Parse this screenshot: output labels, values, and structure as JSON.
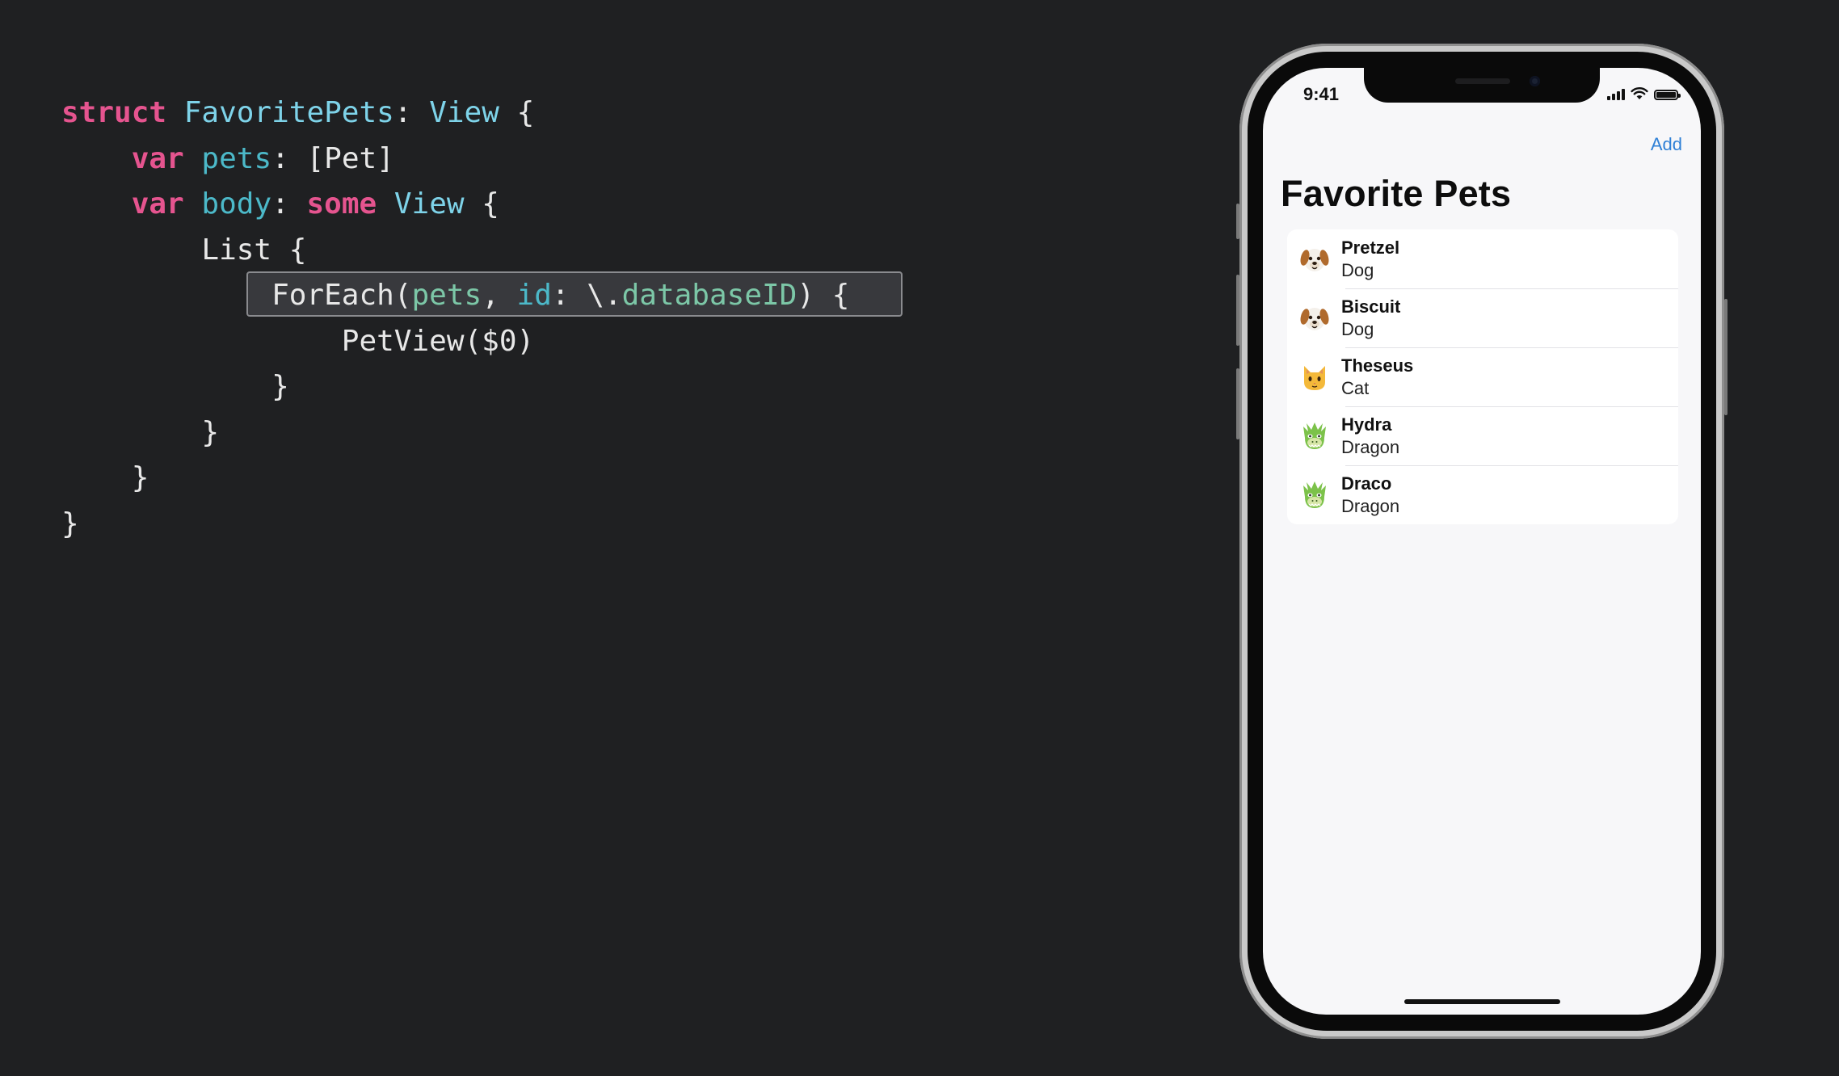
{
  "code": {
    "lines": [
      [
        {
          "t": "struct",
          "c": "kw"
        },
        {
          "t": " ",
          "c": "plain"
        },
        {
          "t": "FavoritePets",
          "c": "type"
        },
        {
          "t": ": ",
          "c": "plain"
        },
        {
          "t": "View",
          "c": "type"
        },
        {
          "t": " {",
          "c": "plain"
        }
      ],
      [
        {
          "t": "    ",
          "c": "plain"
        },
        {
          "t": "var",
          "c": "kw"
        },
        {
          "t": " ",
          "c": "plain"
        },
        {
          "t": "pets",
          "c": "prop"
        },
        {
          "t": ": [Pet]",
          "c": "plain"
        }
      ],
      [
        {
          "t": "    ",
          "c": "plain"
        },
        {
          "t": "var",
          "c": "kw"
        },
        {
          "t": " ",
          "c": "plain"
        },
        {
          "t": "body",
          "c": "prop"
        },
        {
          "t": ": ",
          "c": "plain"
        },
        {
          "t": "some",
          "c": "kw"
        },
        {
          "t": " ",
          "c": "plain"
        },
        {
          "t": "View",
          "c": "type"
        },
        {
          "t": " {",
          "c": "plain"
        }
      ],
      [
        {
          "t": "        List {",
          "c": "plain"
        }
      ],
      [
        {
          "t": "            ForEach(",
          "c": "plain"
        },
        {
          "t": "pets",
          "c": "arg"
        },
        {
          "t": ", ",
          "c": "plain"
        },
        {
          "t": "id",
          "c": "label"
        },
        {
          "t": ": \\.",
          "c": "plain"
        },
        {
          "t": "databaseID",
          "c": "arg"
        },
        {
          "t": ") {",
          "c": "plain"
        }
      ],
      [
        {
          "t": "                PetView($0)",
          "c": "plain"
        }
      ],
      [
        {
          "t": "            }",
          "c": "plain"
        }
      ],
      [
        {
          "t": "        }",
          "c": "plain"
        }
      ],
      [
        {
          "t": "    }",
          "c": "plain"
        }
      ],
      [
        {
          "t": "}",
          "c": "plain"
        }
      ]
    ],
    "highlighted_line": 4
  },
  "phone": {
    "status_time": "9:41",
    "nav_button": "Add",
    "title": "Favorite Pets",
    "pets": [
      {
        "name": "Pretzel",
        "kind": "Dog",
        "icon": "dog-face-icon"
      },
      {
        "name": "Biscuit",
        "kind": "Dog",
        "icon": "dog-face-icon"
      },
      {
        "name": "Theseus",
        "kind": "Cat",
        "icon": "cat-face-icon"
      },
      {
        "name": "Hydra",
        "kind": "Dragon",
        "icon": "dragon-face-icon"
      },
      {
        "name": "Draco",
        "kind": "Dragon",
        "icon": "dragon-face-icon"
      }
    ]
  },
  "colors": {
    "background": "#1f2022",
    "keyword": "#e5548f",
    "type": "#7ed3e9",
    "property": "#4cb9c9",
    "argument": "#7cc7a7",
    "accent": "#2f80d6"
  }
}
